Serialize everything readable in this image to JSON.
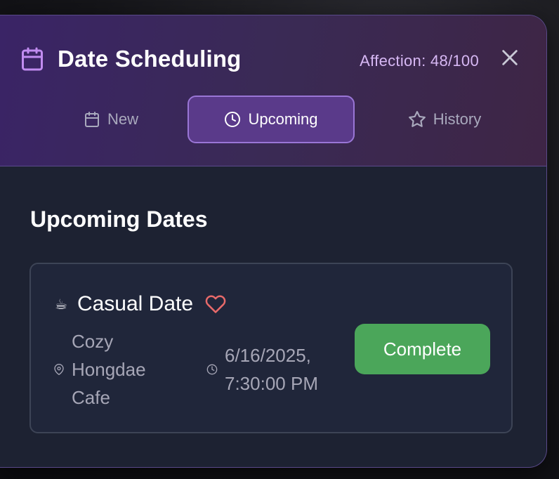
{
  "header": {
    "title": "Date Scheduling",
    "affection": "Affection: 48/100",
    "icon": "calendar-icon",
    "close_icon": "close-icon"
  },
  "tabs": [
    {
      "label": "New",
      "icon": "calendar-icon",
      "active": false
    },
    {
      "label": "Upcoming",
      "icon": "clock-icon",
      "active": true
    },
    {
      "label": "History",
      "icon": "star-icon",
      "active": false
    }
  ],
  "section": {
    "title": "Upcoming Dates"
  },
  "dates": [
    {
      "icon": "☕",
      "title": "Casual Date",
      "location": "Cozy Hongdae Cafe",
      "datetime": "6/16/2025, 7:30:00 PM",
      "action_label": "Complete"
    }
  ],
  "colors": {
    "accent": "#9a76d6",
    "affection_text": "#d7b8f4",
    "complete_button": "#4ba65a",
    "heart": "#e86a6a"
  }
}
